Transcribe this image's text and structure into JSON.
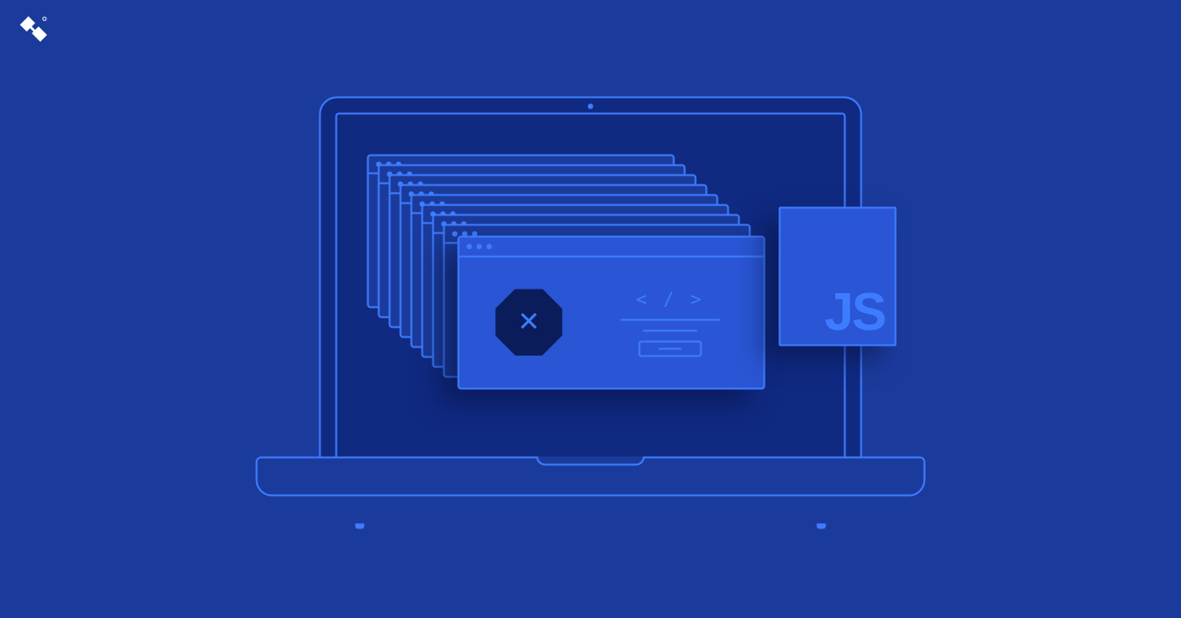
{
  "logo": {
    "name": "toptal"
  },
  "laptop": {
    "stacked_window_count": 9,
    "error_symbol": "✕",
    "code_symbol": "< / >"
  },
  "badge": {
    "label": "JS"
  }
}
